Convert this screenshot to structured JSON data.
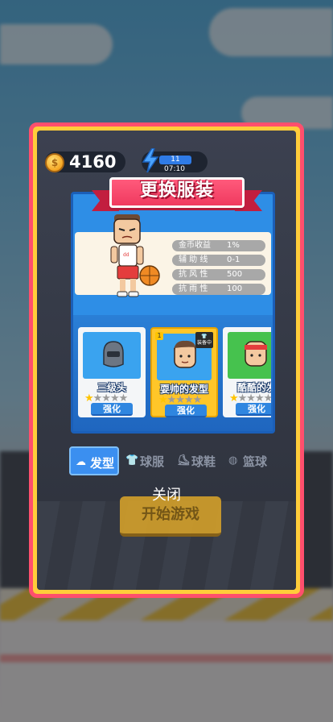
{
  "currency": {
    "coins": "4160"
  },
  "energy": {
    "count": "11",
    "timer": "07:10"
  },
  "title": "更换服装",
  "stats": [
    {
      "label": "金币收益",
      "value": "1%"
    },
    {
      "label": "辅 助 线",
      "value": "0-1"
    },
    {
      "label": "抗 风 性",
      "value": "500"
    },
    {
      "label": "抗 雨 性",
      "value": "100"
    }
  ],
  "items": [
    {
      "name": "三级头",
      "stars": 1,
      "max_stars": 5,
      "button": "强化"
    },
    {
      "name": "耍帅的发型",
      "stars": 1,
      "max_stars": 5,
      "button": "强化",
      "badge_num": "1",
      "equipped_label": "装备中"
    },
    {
      "name": "酷酷的发",
      "stars": 1,
      "max_stars": 5,
      "button": "强化"
    }
  ],
  "tabs": [
    {
      "label": "发型",
      "active": true
    },
    {
      "label": "球服",
      "active": false
    },
    {
      "label": "球鞋",
      "active": false
    },
    {
      "label": "篮球",
      "active": false
    }
  ],
  "close_label": "关闭",
  "start_label": "开始游戏",
  "colors": {
    "frame": "#ff4f6d",
    "frame_border": "#ffcd3a",
    "panel": "#2e8ee6",
    "ribbon": "#f03a5f",
    "star": "#ffc400"
  }
}
